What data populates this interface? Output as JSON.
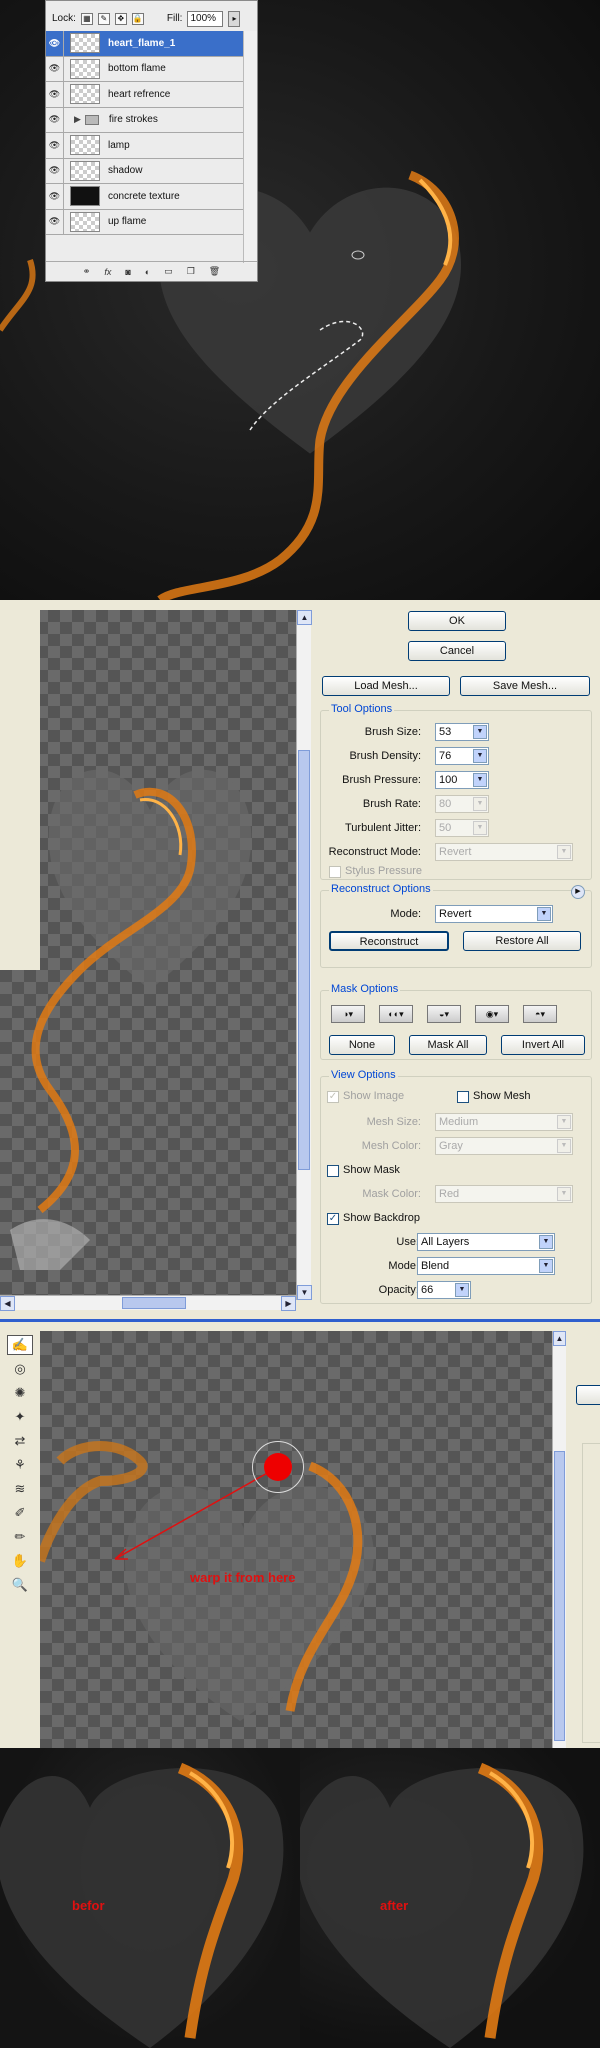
{
  "layers_panel": {
    "lock_label": "Lock:",
    "fill_label": "Fill:",
    "fill_value": "100%",
    "layers": [
      {
        "name": "heart_flame_1",
        "selected": true
      },
      {
        "name": "bottom flame"
      },
      {
        "name": "heart refrence"
      },
      {
        "name": "fire strokes",
        "folder": true
      },
      {
        "name": "lamp"
      },
      {
        "name": "shadow"
      },
      {
        "name": "concrete texture",
        "dark": true
      },
      {
        "name": "up flame"
      }
    ]
  },
  "liquify": {
    "ok": "OK",
    "cancel": "Cancel",
    "load_mesh": "Load Mesh...",
    "save_mesh": "Save Mesh...",
    "tool_options": {
      "title": "Tool Options",
      "brush_size_label": "Brush Size:",
      "brush_size": "53",
      "brush_density_label": "Brush Density:",
      "brush_density": "76",
      "brush_pressure_label": "Brush Pressure:",
      "brush_pressure": "100",
      "brush_rate_label": "Brush Rate:",
      "brush_rate": "80",
      "turbulent_jitter_label": "Turbulent Jitter:",
      "turbulent_jitter": "50",
      "reconstruct_mode_label": "Reconstruct Mode:",
      "reconstruct_mode": "Revert",
      "stylus_pressure": "Stylus Pressure"
    },
    "reconstruct_options": {
      "title": "Reconstruct Options",
      "mode_label": "Mode:",
      "mode": "Revert",
      "reconstruct": "Reconstruct",
      "restore_all": "Restore All"
    },
    "mask_options": {
      "title": "Mask Options",
      "none": "None",
      "mask_all": "Mask All",
      "invert_all": "Invert All"
    },
    "view_options": {
      "title": "View Options",
      "show_image": "Show Image",
      "show_mesh": "Show Mesh",
      "mesh_size_label": "Mesh Size:",
      "mesh_size": "Medium",
      "mesh_color_label": "Mesh Color:",
      "mesh_color": "Gray",
      "show_mask": "Show Mask",
      "mask_color_label": "Mask Color:",
      "mask_color": "Red",
      "show_backdrop": "Show Backdrop",
      "use_label": "Use:",
      "use": "All Layers",
      "mode_label": "Mode:",
      "mode": "Blend",
      "opacity_label": "Opacity:",
      "opacity": "66"
    }
  },
  "annotation": {
    "warp_text": "warp it from here"
  },
  "comparison": {
    "before": "befor",
    "after": "after"
  },
  "colors": {
    "accent": "#3a6fc9",
    "annotation_red": "#e01010",
    "flame": "#f28a1a"
  }
}
